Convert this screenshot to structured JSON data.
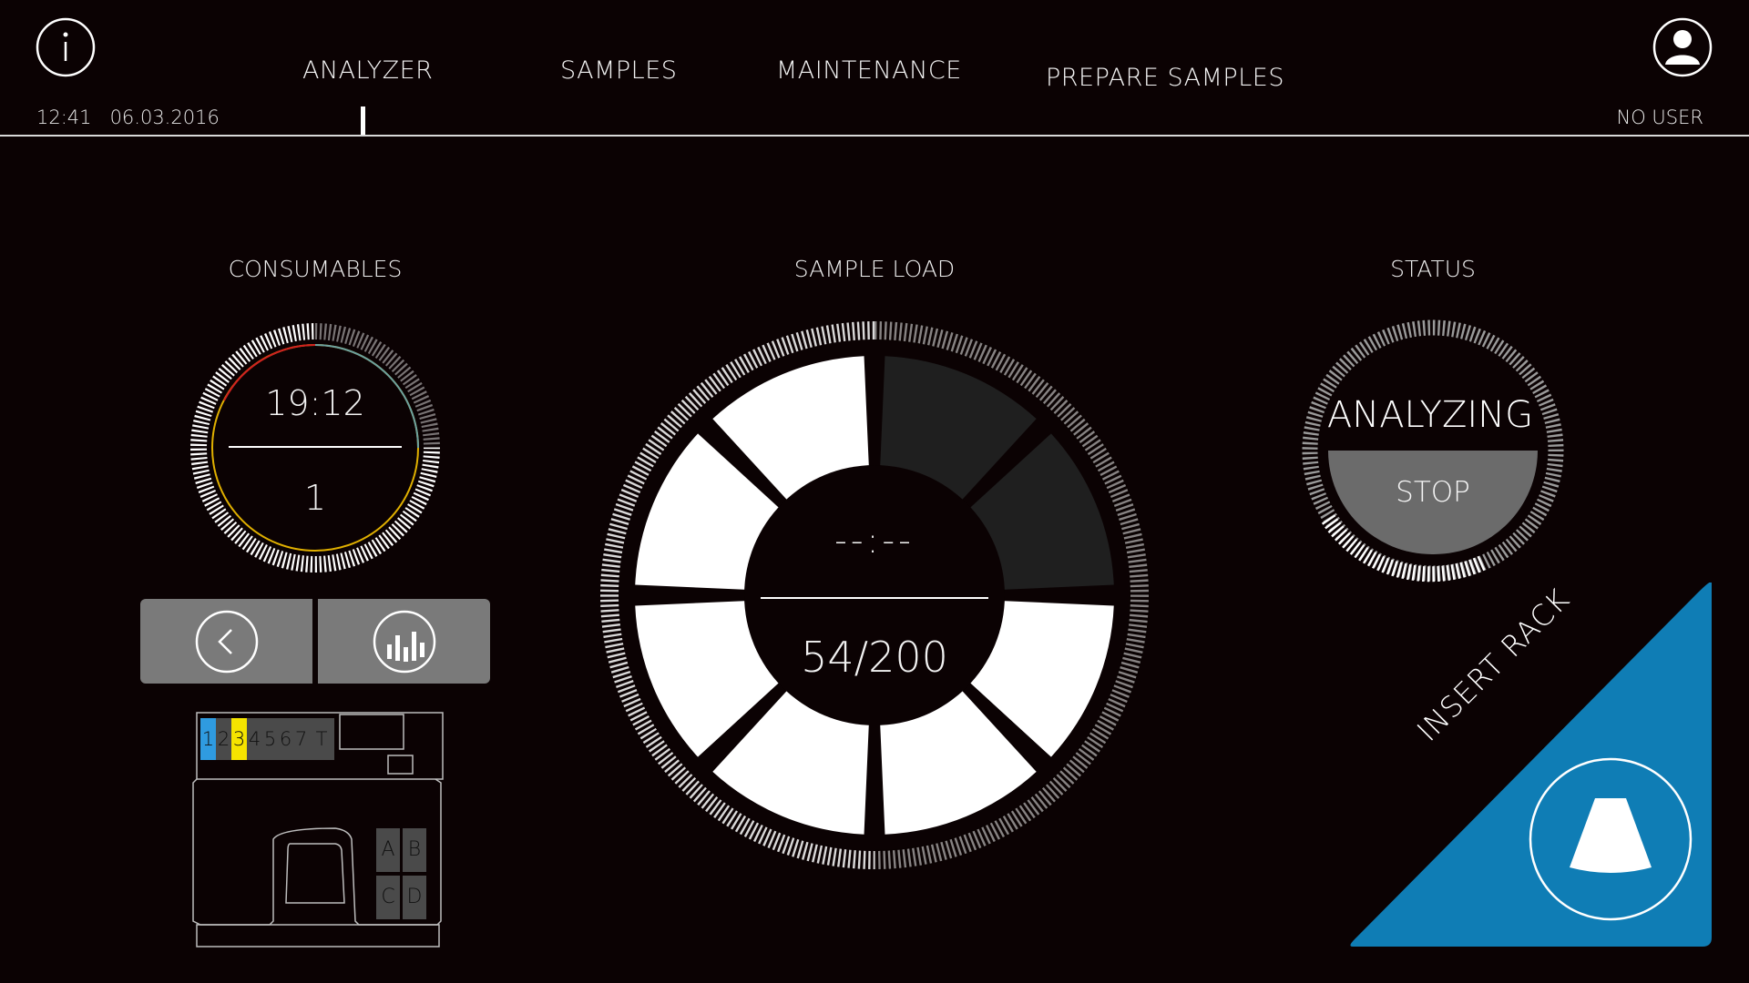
{
  "header": {
    "info_icon": "info-icon",
    "user_icon": "user-icon",
    "tabs": [
      {
        "label": "ANALYZER",
        "active": true
      },
      {
        "label": "SAMPLES",
        "active": false
      },
      {
        "label": "MAINTENANCE",
        "active": false
      },
      {
        "label": "PREPARE SAMPLES",
        "active": false
      }
    ],
    "time": "12:41",
    "date": "06.03.2016",
    "user": "NO USER"
  },
  "consumables": {
    "title": "CONSUMABLES",
    "time": "19:12",
    "count": "1",
    "back_icon": "chevron-left-icon",
    "stats_icon": "bar-chart-icon"
  },
  "tray": {
    "slots": [
      "1",
      "2",
      "3",
      "4",
      "5",
      "6",
      "7",
      "T"
    ],
    "slot_colors": [
      "#2f9be0",
      "#4a4a4a",
      "#f5e400",
      "#4a4a4a",
      "#4a4a4a",
      "#4a4a4a",
      "#4a4a4a",
      "#4a4a4a"
    ],
    "bays": [
      "A",
      "B",
      "C",
      "D"
    ]
  },
  "sample_load": {
    "title": "SAMPLE LOAD",
    "time": "--:--",
    "count": "54/200",
    "segments_total": 8,
    "segments_filled": 6
  },
  "status": {
    "title": "STATUS",
    "state": "ANALYZING",
    "stop_label": "STOP"
  },
  "insert_rack": {
    "label": "INSERT RACK",
    "color": "#0f7db5",
    "icon": "rack-icon"
  },
  "colors": {
    "background": "#0b0203",
    "accent_blue": "#0f7db5",
    "button_gray": "#7a7a7a"
  }
}
